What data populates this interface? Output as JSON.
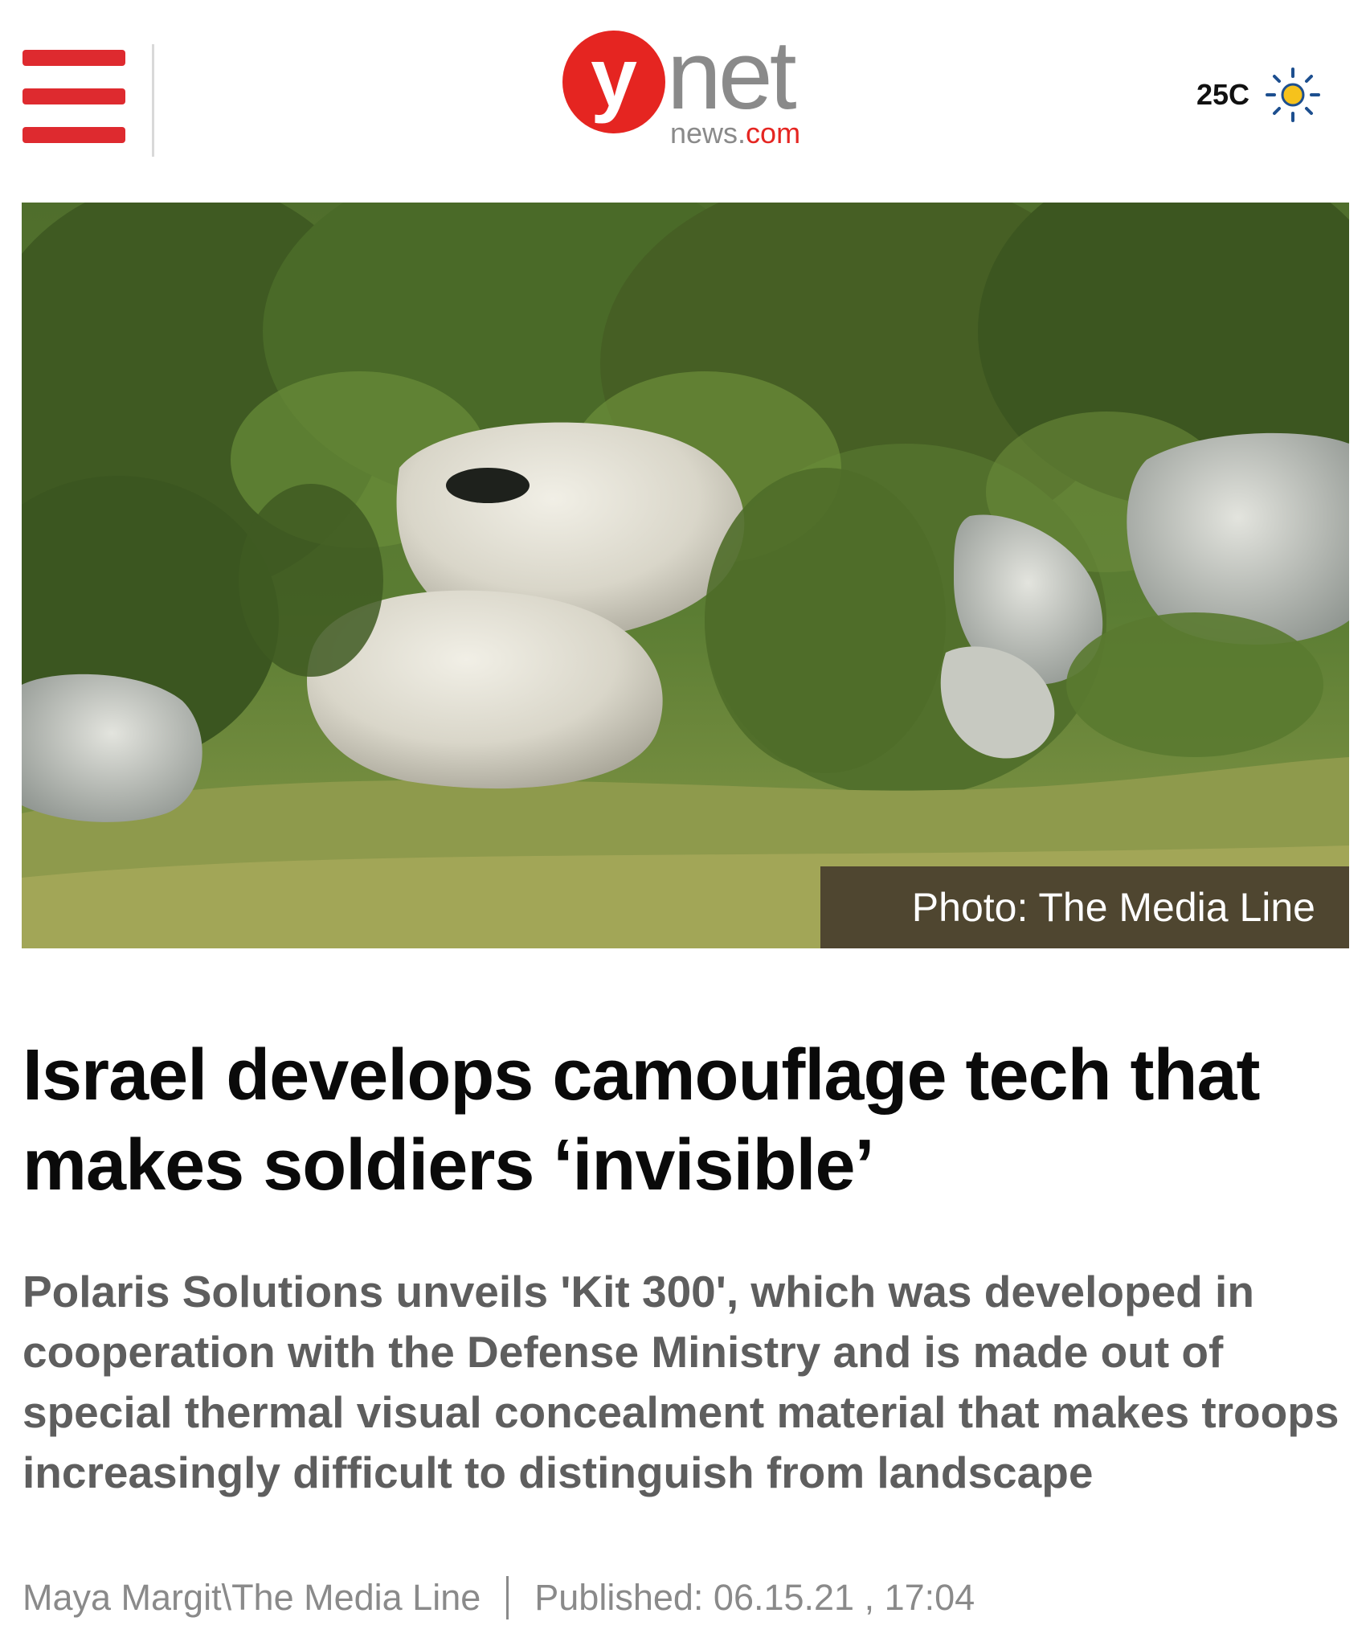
{
  "header": {
    "logo": {
      "letter": "y",
      "word": "net",
      "sub_news": "news.",
      "sub_com": "com"
    },
    "weather": {
      "temperature": "25C",
      "icon": "sun-icon"
    },
    "menu_icon": "hamburger-menu-icon"
  },
  "hero": {
    "photo_credit": "Photo: The Media Line"
  },
  "article": {
    "headline": "Israel develops camouflage tech that makes soldiers ‘invisible’",
    "subheadline": "Polaris Solutions unveils 'Kit 300', which was developed in cooperation with the Defense Ministry and is made out of special thermal visual concealment material that makes troops increasingly difficult to distinguish from landscape",
    "author": "Maya Margit\\The Media Line",
    "published": "Published: 06.15.21 , 17:04"
  },
  "colors": {
    "brand_red": "#e52521",
    "menu_red": "#de2a2f",
    "logo_gray": "#8a8a8a",
    "headline": "#0a0a0a",
    "subheadline": "#5e5e5e",
    "byline": "#8a8a8a"
  }
}
